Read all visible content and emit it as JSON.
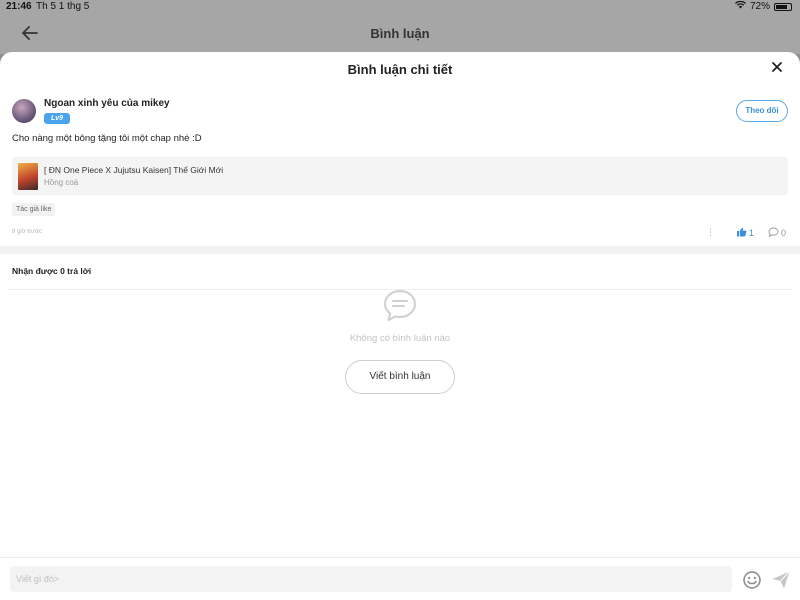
{
  "status_bar": {
    "time": "21:46",
    "date": "Th 5 1 thg 5",
    "battery": "72%"
  },
  "background_header": {
    "title": "Bình luận"
  },
  "sheet": {
    "title": "Bình luận chi tiết"
  },
  "comment": {
    "username": "Ngoan xinh yêu của mikey",
    "level": "Lv9",
    "follow_label": "Theo dõi",
    "text": "Cho nàng một bông tặng tôi một chap nhé :D",
    "story": {
      "title": "[ ĐN One Piece X Jujutsu Kaisen] Thế Giới Mới",
      "author": "Hồng coá"
    },
    "badge": "Tác giả like",
    "time_ago": "9 giờ trước",
    "more": "⋮",
    "likes": "1",
    "replies": "0"
  },
  "replies_section": {
    "heading": "Nhận được 0 trả lời",
    "empty_text": "Không có bình luận nào",
    "write_label": "Viết bình luận"
  },
  "input_bar": {
    "placeholder": "Viết gì đó>"
  },
  "colors": {
    "accent": "#4aa3ec",
    "sheet_bg": "#ffffff",
    "overlay": "#a6a6a6"
  },
  "icons": {
    "back": "arrow-left-icon",
    "close": "close-icon",
    "like": "thumbs-up-icon",
    "reply": "chat-bubble-icon",
    "empty": "chat-bubble-icon",
    "emoji": "smiley-icon",
    "send": "send-icon"
  }
}
